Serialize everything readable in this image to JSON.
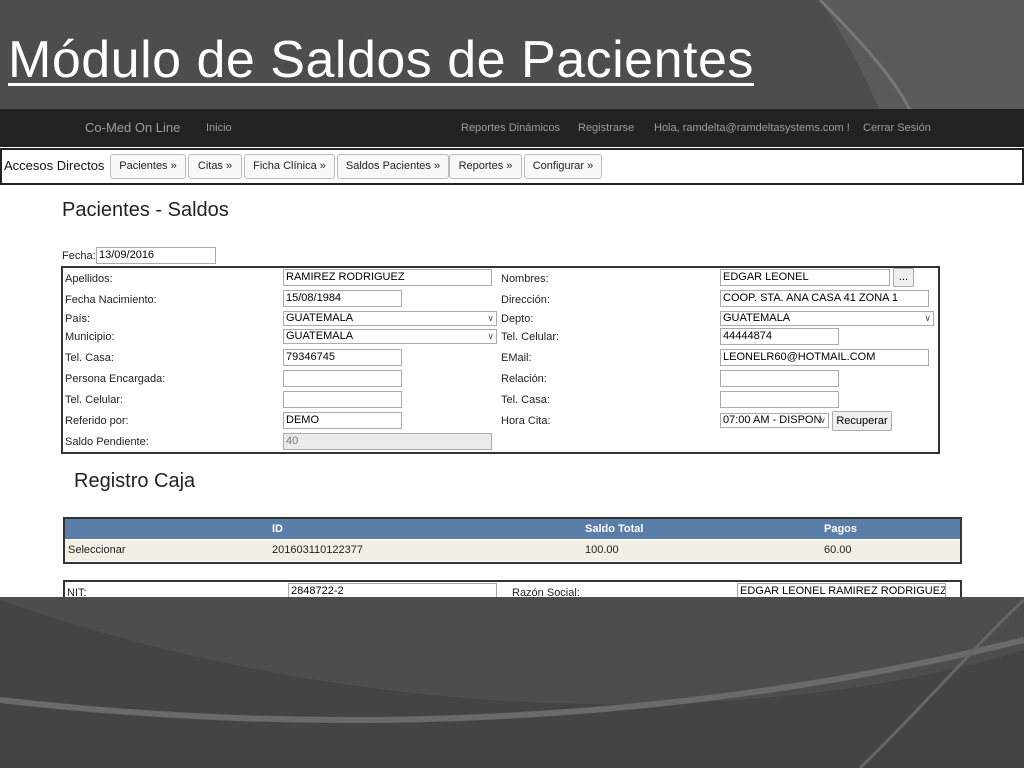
{
  "slide": {
    "title": "Módulo de Saldos de Pacientes"
  },
  "navbar": {
    "brand": "Co-Med On Line",
    "home": "Inicio",
    "reports": "Reportes Dinámicos",
    "register": "Registrarse",
    "greeting": "Hola, ramdelta@ramdeltasystems.com !",
    "logout": "Cerrar Sesión"
  },
  "quick_access": {
    "label": "Accesos Directos",
    "buttons": [
      "Pacientes »",
      "Citas »",
      "Ficha Clínica »",
      "Saldos Pacientes »",
      "Reportes »",
      "Configurar »"
    ]
  },
  "page": {
    "title": "Pacientes - Saldos"
  },
  "fecha": {
    "label": "Fecha:",
    "value": "13/09/2016"
  },
  "patient": {
    "apellidos_label": "Apellidos:",
    "apellidos": "RAMIREZ RODRIGUEZ",
    "nombres_label": "Nombres:",
    "nombres": "EDGAR LEONEL",
    "lookup_button": "...",
    "fecha_nac_label": "Fecha Nacimiento:",
    "fecha_nac": "15/08/1984",
    "direccion_label": "Dirección:",
    "direccion": "COOP. STA. ANA CASA 41 ZONA 1",
    "pais_label": "País:",
    "pais": "GUATEMALA",
    "depto_label": "Depto:",
    "depto": "GUATEMALA",
    "municipio_label": "Municipio:",
    "municipio": "GUATEMALA",
    "tel_celular_label": "Tel. Celular:",
    "tel_celular": "44444874",
    "tel_casa_label": "Tel. Casa:",
    "tel_casa": "79346745",
    "email_label": "EMail:",
    "email": "LEONELR60@HOTMAIL.COM",
    "persona_label": "Persona Encargada:",
    "persona": "",
    "relacion_label": "Relación:",
    "relacion": "",
    "enc_tel_celular_label": "Tel. Celular:",
    "enc_tel_celular": "",
    "enc_tel_casa_label": "Tel. Casa:",
    "enc_tel_casa": "",
    "referido_label": "Referido por:",
    "referido": "DEMO",
    "hora_cita_label": "Hora Cita:",
    "hora_cita": "07:00 AM - DISPON",
    "recuperar_button": "Recuperar",
    "saldo_label": "Saldo Pendiente:",
    "saldo": "40"
  },
  "caja": {
    "title": "Registro Caja",
    "columns": [
      "ID",
      "Saldo Total",
      "Pagos"
    ],
    "rows": [
      {
        "action": "Seleccionar",
        "id": "201603110122377",
        "saldo_total": "100.00",
        "pagos": "60.00"
      }
    ]
  },
  "factura": {
    "nit_label": "NIT:",
    "nit": "2848722-2",
    "razon_label": "Razón Social:",
    "razon": "EDGAR LEONEL RAMIREZ RODRIGUEZ"
  },
  "colors": {
    "navbar": "#222222",
    "grid_header": "#5a7ea8",
    "grid_row": "#f1efe6",
    "slide_bg": "#4a4a4a"
  }
}
